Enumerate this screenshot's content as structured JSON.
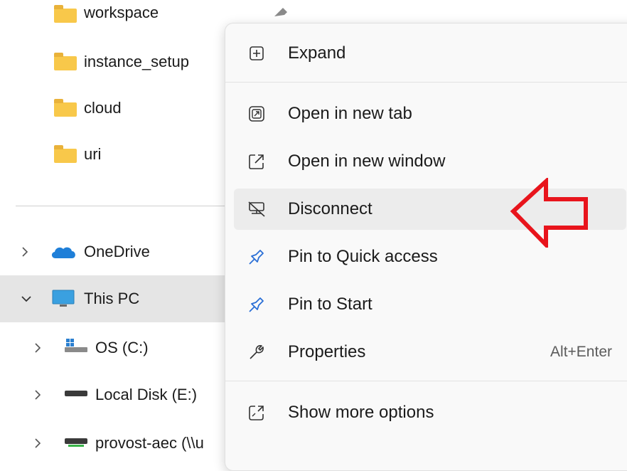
{
  "sidebar": {
    "folders": [
      {
        "label": "workspace"
      },
      {
        "label": "instance_setup"
      },
      {
        "label": "cloud"
      },
      {
        "label": "uri"
      }
    ],
    "tree": [
      {
        "label": "OneDrive"
      },
      {
        "label": "This PC"
      },
      {
        "label": "OS (C:)"
      },
      {
        "label": "Local Disk (E:)"
      },
      {
        "label": "provost-aec (\\\\u"
      }
    ]
  },
  "context_menu": {
    "items": [
      {
        "label": "Expand",
        "icon": "expand-plus-icon"
      },
      {
        "label": "Open in new tab",
        "icon": "new-tab-icon"
      },
      {
        "label": "Open in new window",
        "icon": "new-window-icon"
      },
      {
        "label": "Disconnect",
        "icon": "disconnect-drive-icon"
      },
      {
        "label": "Pin to Quick access",
        "icon": "pin-icon"
      },
      {
        "label": "Pin to Start",
        "icon": "pin-icon"
      },
      {
        "label": "Properties",
        "icon": "wrench-icon",
        "shortcut": "Alt+Enter"
      },
      {
        "label": "Show more options",
        "icon": "show-more-icon"
      }
    ]
  },
  "colors": {
    "annotation_arrow": "#e8141c",
    "pin_blue": "#2a6fd6",
    "folder_yellow": "#f8c84a",
    "onedrive_blue": "#1f7fd8",
    "pc_blue": "#3aa0e0"
  }
}
